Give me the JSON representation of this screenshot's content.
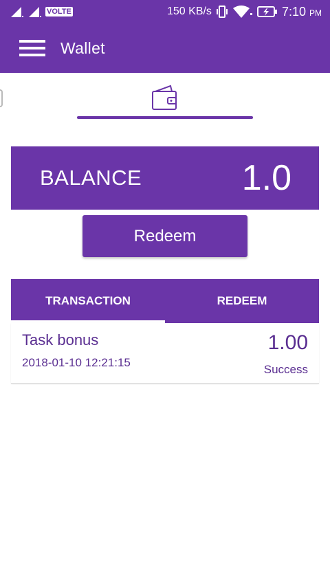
{
  "status_bar": {
    "network_badge": "VOLTE",
    "speed": "150 KB/s",
    "time": "7:10",
    "ampm": "PM",
    "icons": [
      "signal-icon",
      "signal-icon",
      "vibrate-icon",
      "wifi-icon",
      "battery-charging-icon"
    ]
  },
  "toolbar": {
    "title": "Wallet",
    "menu_icon": "hamburger-menu-icon"
  },
  "tabs": {
    "active_icon": "wallet-icon"
  },
  "balance": {
    "label": "BALANCE",
    "value": "1.0"
  },
  "redeem_button": {
    "label": "Redeem"
  },
  "sub_tabs": [
    {
      "label": "TRANSACTION",
      "active": true
    },
    {
      "label": "REDEEM",
      "active": false
    }
  ],
  "transactions": [
    {
      "description": "Task bonus",
      "date": "2018-01-10 12:21:15",
      "amount": "1.00",
      "status": "Success"
    }
  ],
  "colors": {
    "primary": "#6a35a8",
    "text_primary": "#5a2e91",
    "background": "#ffffff"
  }
}
